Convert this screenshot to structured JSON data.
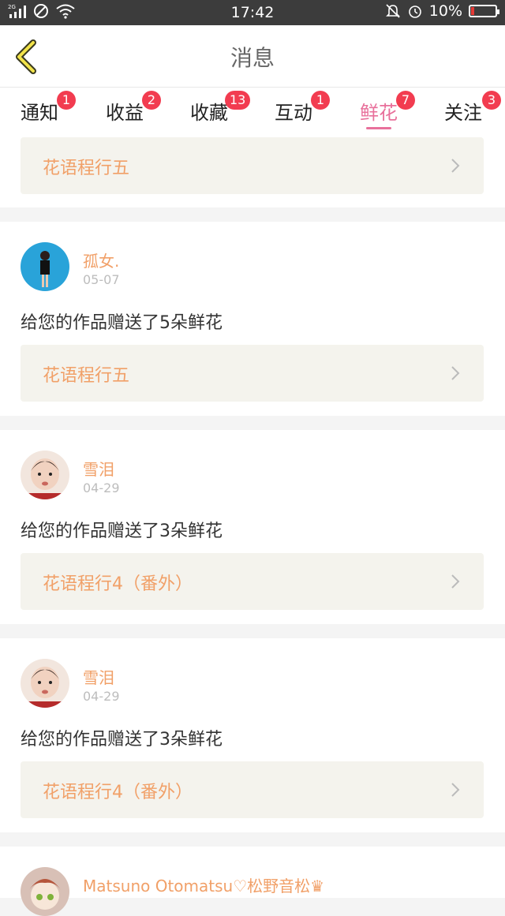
{
  "status_bar": {
    "time": "17:42",
    "battery": "10%",
    "network": "2G"
  },
  "header": {
    "title": "消息"
  },
  "tabs": [
    {
      "label": "通知",
      "badge": "1"
    },
    {
      "label": "收益",
      "badge": "2"
    },
    {
      "label": "收藏",
      "badge": "13"
    },
    {
      "label": "互动",
      "badge": "1"
    },
    {
      "label": "鲜花",
      "badge": "7",
      "active": true
    },
    {
      "label": "关注",
      "badge": "3"
    }
  ],
  "top_item": {
    "work": "花语程行五"
  },
  "messages": [
    {
      "name": "孤女.",
      "date": "05-07",
      "text": "给您的作品赠送了5朵鲜花",
      "work": "花语程行五"
    },
    {
      "name": "雪泪",
      "date": "04-29",
      "text": "给您的作品赠送了3朵鲜花",
      "work": "花语程行4（番外）"
    },
    {
      "name": "雪泪",
      "date": "04-29",
      "text": "给您的作品赠送了3朵鲜花",
      "work": "花语程行4（番外）"
    },
    {
      "name": "Matsuno Otomatsu♡松野音松♛"
    }
  ],
  "colors": {
    "accent": "#e8709b",
    "name": "#f1a068",
    "badge": "#f23c50",
    "card": "#f4f3ed"
  }
}
